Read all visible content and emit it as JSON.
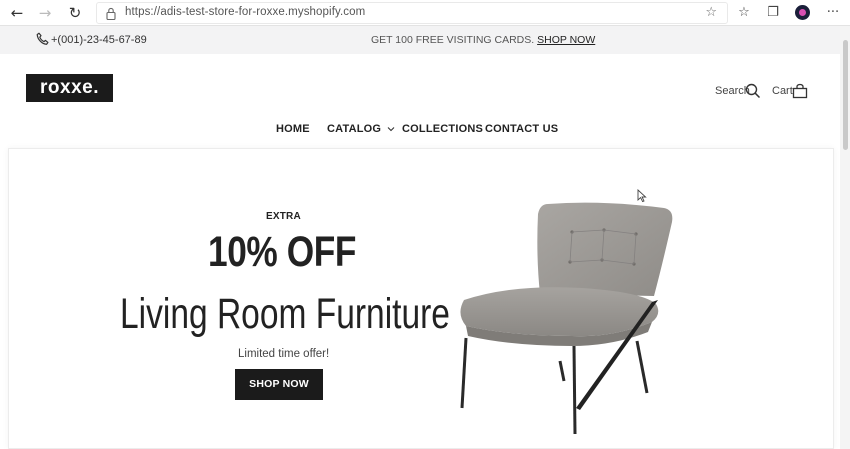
{
  "browser": {
    "back_icon": "back-arrow-icon",
    "forward_icon": "forward-arrow-icon",
    "reload_icon": "reload-icon",
    "url": "https://adis-test-store-for-roxxe.myshopify.com",
    "more_label": "···"
  },
  "announcement": {
    "phone": "+(001)-23-45-67-89",
    "promo_text": "GET 100 FREE VISITING CARDS.",
    "promo_link": "SHOP NOW"
  },
  "header": {
    "logo": "roxxe.",
    "search_label": "Search",
    "cart_label": "Cart"
  },
  "nav": {
    "items": [
      {
        "label": "HOME"
      },
      {
        "label": "CATALOG"
      },
      {
        "label": "COLLECTIONS"
      },
      {
        "label": "CONTACT US"
      }
    ]
  },
  "hero": {
    "eyebrow": "EXTRA",
    "headline": "10% OFF",
    "subheadline": "Living Room Furniture",
    "tagline": "Limited time offer!",
    "button": "SHOP NOW"
  }
}
